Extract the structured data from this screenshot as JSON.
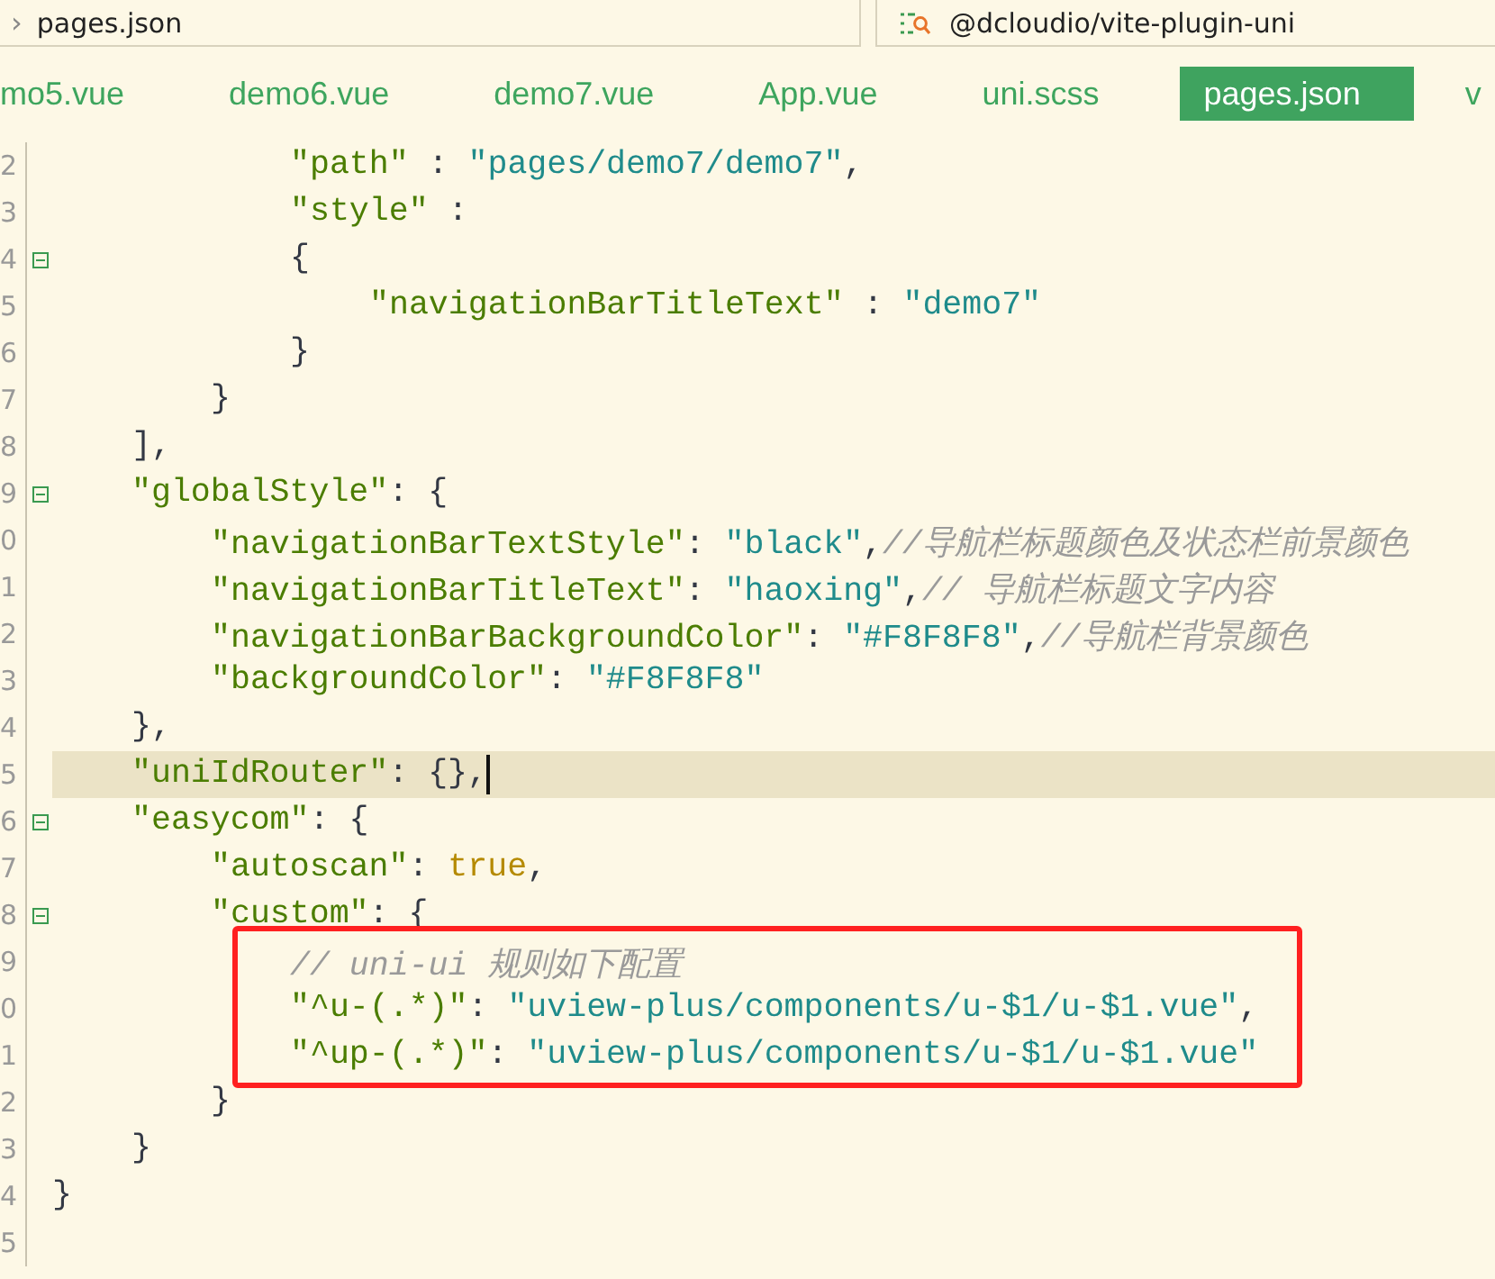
{
  "breadcrumb": {
    "chevron": "›",
    "file": "pages.json"
  },
  "search_box": {
    "text": "@dcloudio/vite-plugin-uni"
  },
  "tabs": [
    {
      "label": "mo5.vue",
      "selected": false
    },
    {
      "label": "demo6.vue",
      "selected": false
    },
    {
      "label": "demo7.vue",
      "selected": false
    },
    {
      "label": "App.vue",
      "selected": false
    },
    {
      "label": "uni.scss",
      "selected": false
    },
    {
      "label": "pages.json",
      "selected": true
    },
    {
      "label": "v",
      "selected": false
    }
  ],
  "editor": {
    "lines": [
      {
        "number": "2",
        "fold_marker": false,
        "current": false,
        "boxed": false,
        "tokens": [
          {
            "kind": "key",
            "text": "\"path\""
          },
          {
            "kind": "punct",
            "text": " : "
          },
          {
            "kind": "string",
            "text": "\"pages/demo7/demo7\""
          },
          {
            "kind": "punct",
            "text": ","
          }
        ]
      },
      {
        "number": "3",
        "fold_marker": false,
        "current": false,
        "boxed": false,
        "tokens": [
          {
            "kind": "key",
            "text": "\"style\""
          },
          {
            "kind": "punct",
            "text": " :"
          }
        ]
      },
      {
        "number": "4",
        "fold_marker": true,
        "current": false,
        "boxed": false,
        "tokens": [
          {
            "kind": "punct",
            "text": "{"
          }
        ]
      },
      {
        "number": "5",
        "fold_marker": false,
        "current": false,
        "boxed": false,
        "tokens": [
          {
            "kind": "key",
            "text": "\"navigationBarTitleText\""
          },
          {
            "kind": "punct",
            "text": " : "
          },
          {
            "kind": "string",
            "text": "\"demo7\""
          }
        ]
      },
      {
        "number": "6",
        "fold_marker": false,
        "current": false,
        "boxed": false,
        "tokens": [
          {
            "kind": "punct",
            "text": "}"
          }
        ]
      },
      {
        "number": "7",
        "fold_marker": false,
        "current": false,
        "boxed": false,
        "tokens": [
          {
            "kind": "punct",
            "text": "}"
          }
        ]
      },
      {
        "number": "8",
        "fold_marker": false,
        "current": false,
        "boxed": false,
        "tokens": [
          {
            "kind": "punct",
            "text": "],"
          }
        ]
      },
      {
        "number": "9",
        "fold_marker": true,
        "current": false,
        "boxed": false,
        "tokens": [
          {
            "kind": "key",
            "text": "\"globalStyle\""
          },
          {
            "kind": "punct",
            "text": ": {"
          }
        ]
      },
      {
        "number": "0",
        "fold_marker": false,
        "current": false,
        "boxed": false,
        "tokens": [
          {
            "kind": "key",
            "text": "\"navigationBarTextStyle\""
          },
          {
            "kind": "punct",
            "text": ": "
          },
          {
            "kind": "string",
            "text": "\"black\""
          },
          {
            "kind": "punct",
            "text": ","
          },
          {
            "kind": "comment",
            "text": "//导航栏标题颜色及状态栏前景颜色"
          }
        ]
      },
      {
        "number": "1",
        "fold_marker": false,
        "current": false,
        "boxed": false,
        "tokens": [
          {
            "kind": "key",
            "text": "\"navigationBarTitleText\""
          },
          {
            "kind": "punct",
            "text": ": "
          },
          {
            "kind": "string",
            "text": "\"haoxing\""
          },
          {
            "kind": "punct",
            "text": ","
          },
          {
            "kind": "comment",
            "text": "// 导航栏标题文字内容"
          }
        ]
      },
      {
        "number": "2",
        "fold_marker": false,
        "current": false,
        "boxed": false,
        "tokens": [
          {
            "kind": "key",
            "text": "\"navigationBarBackgroundColor\""
          },
          {
            "kind": "punct",
            "text": ": "
          },
          {
            "kind": "string",
            "text": "\"#F8F8F8\""
          },
          {
            "kind": "punct",
            "text": ","
          },
          {
            "kind": "comment",
            "text": "//导航栏背景颜色"
          }
        ]
      },
      {
        "number": "3",
        "fold_marker": false,
        "current": false,
        "boxed": false,
        "tokens": [
          {
            "kind": "key",
            "text": "\"backgroundColor\""
          },
          {
            "kind": "punct",
            "text": ": "
          },
          {
            "kind": "string",
            "text": "\"#F8F8F8\""
          }
        ]
      },
      {
        "number": "4",
        "fold_marker": false,
        "current": false,
        "boxed": false,
        "tokens": [
          {
            "kind": "punct",
            "text": "},"
          }
        ]
      },
      {
        "number": "5",
        "fold_marker": false,
        "current": true,
        "boxed": false,
        "tokens": [
          {
            "kind": "key",
            "text": "\"uniIdRouter\""
          },
          {
            "kind": "punct",
            "text": ": {},"
          }
        ]
      },
      {
        "number": "6",
        "fold_marker": true,
        "current": false,
        "boxed": false,
        "tokens": [
          {
            "kind": "key",
            "text": "\"easycom\""
          },
          {
            "kind": "punct",
            "text": ": {"
          }
        ]
      },
      {
        "number": "7",
        "fold_marker": false,
        "current": false,
        "boxed": false,
        "tokens": [
          {
            "kind": "key",
            "text": "\"autoscan\""
          },
          {
            "kind": "punct",
            "text": ": "
          },
          {
            "kind": "boolean",
            "text": "true"
          },
          {
            "kind": "punct",
            "text": ","
          }
        ]
      },
      {
        "number": "8",
        "fold_marker": true,
        "current": false,
        "boxed": false,
        "tokens": [
          {
            "kind": "key",
            "text": "\"custom\""
          },
          {
            "kind": "punct",
            "text": ": {"
          }
        ]
      },
      {
        "number": "9",
        "fold_marker": false,
        "current": false,
        "boxed": true,
        "tokens": [
          {
            "kind": "comment",
            "text": "// uni-ui 规则如下配置"
          }
        ]
      },
      {
        "number": "0",
        "fold_marker": false,
        "current": false,
        "boxed": true,
        "tokens": [
          {
            "kind": "key",
            "text": "\"^u-(.*)\""
          },
          {
            "kind": "punct",
            "text": ": "
          },
          {
            "kind": "string",
            "text": "\"uview-plus/components/u-$1/u-$1.vue\""
          },
          {
            "kind": "punct",
            "text": ","
          }
        ]
      },
      {
        "number": "1",
        "fold_marker": false,
        "current": false,
        "boxed": true,
        "tokens": [
          {
            "kind": "key",
            "text": "\"^up-(.*)\""
          },
          {
            "kind": "punct",
            "text": ": "
          },
          {
            "kind": "string",
            "text": "\"uview-plus/components/u-$1/u-$1.vue\""
          }
        ]
      },
      {
        "number": "2",
        "fold_marker": false,
        "current": false,
        "boxed": false,
        "tokens": [
          {
            "kind": "punct",
            "text": "}"
          }
        ]
      },
      {
        "number": "3",
        "fold_marker": false,
        "current": false,
        "boxed": false,
        "tokens": [
          {
            "kind": "punct",
            "text": "}"
          }
        ]
      },
      {
        "number": "4",
        "fold_marker": false,
        "current": false,
        "boxed": false,
        "tokens": [
          {
            "kind": "punct",
            "text": "}"
          }
        ]
      },
      {
        "number": "5",
        "fold_marker": false,
        "current": false,
        "boxed": false
      }
    ]
  }
}
